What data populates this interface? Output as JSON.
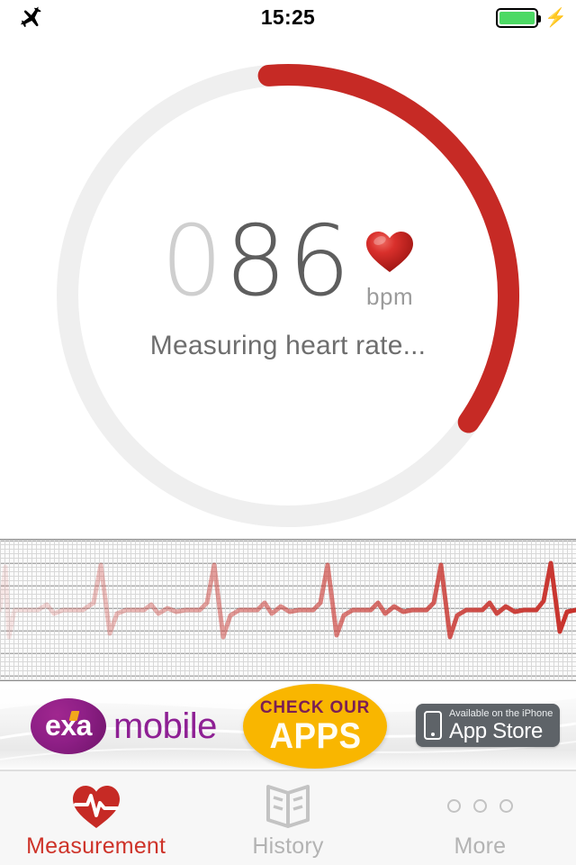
{
  "status_bar": {
    "airplane_icon": "airplane-icon",
    "time": "15:25",
    "battery_icon": "battery-full-icon",
    "charging_icon": "charging-bolt-icon",
    "battery_color": "#4CD964"
  },
  "measurement": {
    "digits_dim": "0",
    "digits_on": "86",
    "value": 86,
    "unit": "bpm",
    "heart_icon": "heart-icon",
    "status_text": "Measuring heart rate...",
    "progress_percent": 35,
    "ring_track_color": "#efefef",
    "ring_progress_color": "#C62A25",
    "ring_start_angle_deg": -5,
    "ring_end_angle_deg": 125
  },
  "ecg": {
    "name": "ecg-waveform",
    "trace_color": "#C8312B",
    "grid_color": "#d8d8d8",
    "grid_major_color": "#5a5a5a"
  },
  "ad_banner": {
    "brand_logo_text": "exa",
    "brand_name": "mobile",
    "brand_color": "#8e2094",
    "promo_top": "CHECK OUR",
    "promo_main": "APPS",
    "promo_circle_color": "#F9B600",
    "store_badge_small": "Available on the iPhone",
    "store_badge_large": "App Store",
    "store_badge_color": "#5E6368",
    "phone_icon": "iphone-icon"
  },
  "tab_bar": {
    "tabs": [
      {
        "label": "Measurement",
        "icon": "heart-pulse-icon",
        "active": true
      },
      {
        "label": "History",
        "icon": "open-book-icon",
        "active": false
      },
      {
        "label": "More",
        "icon": "three-dots-icon",
        "active": false
      }
    ],
    "active_color": "#CE3329",
    "inactive_color": "#b3b3b3"
  }
}
